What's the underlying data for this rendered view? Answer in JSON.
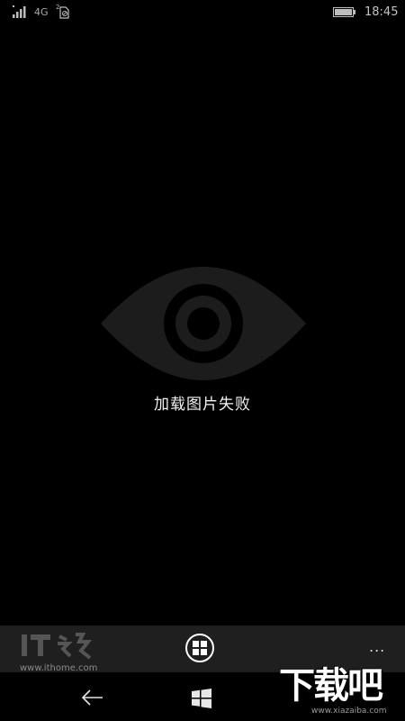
{
  "status_bar": {
    "network": "4G",
    "sim_badge": "2",
    "time": "18:45",
    "icons": [
      "signal-strength-icon",
      "sim-card-icon",
      "battery-icon"
    ]
  },
  "content": {
    "placeholder_icon": "eye-icon",
    "error_message": "加载图片失败"
  },
  "app_bar": {
    "center_button_icon": "gallery-grid-icon",
    "more_label": "..."
  },
  "nav_bar": {
    "icons": [
      "back-arrow-icon",
      "windows-start-icon"
    ]
  },
  "watermarks": {
    "ithome_url": "www.ithome.com",
    "xiazaiba_text": "下载吧",
    "xiazaiba_url": "www.xiazaiba.com"
  },
  "colors": {
    "background": "#000000",
    "app_bar": "#1f1f1f",
    "eye": "#1c1c1c",
    "text": "#f2f2f2"
  }
}
